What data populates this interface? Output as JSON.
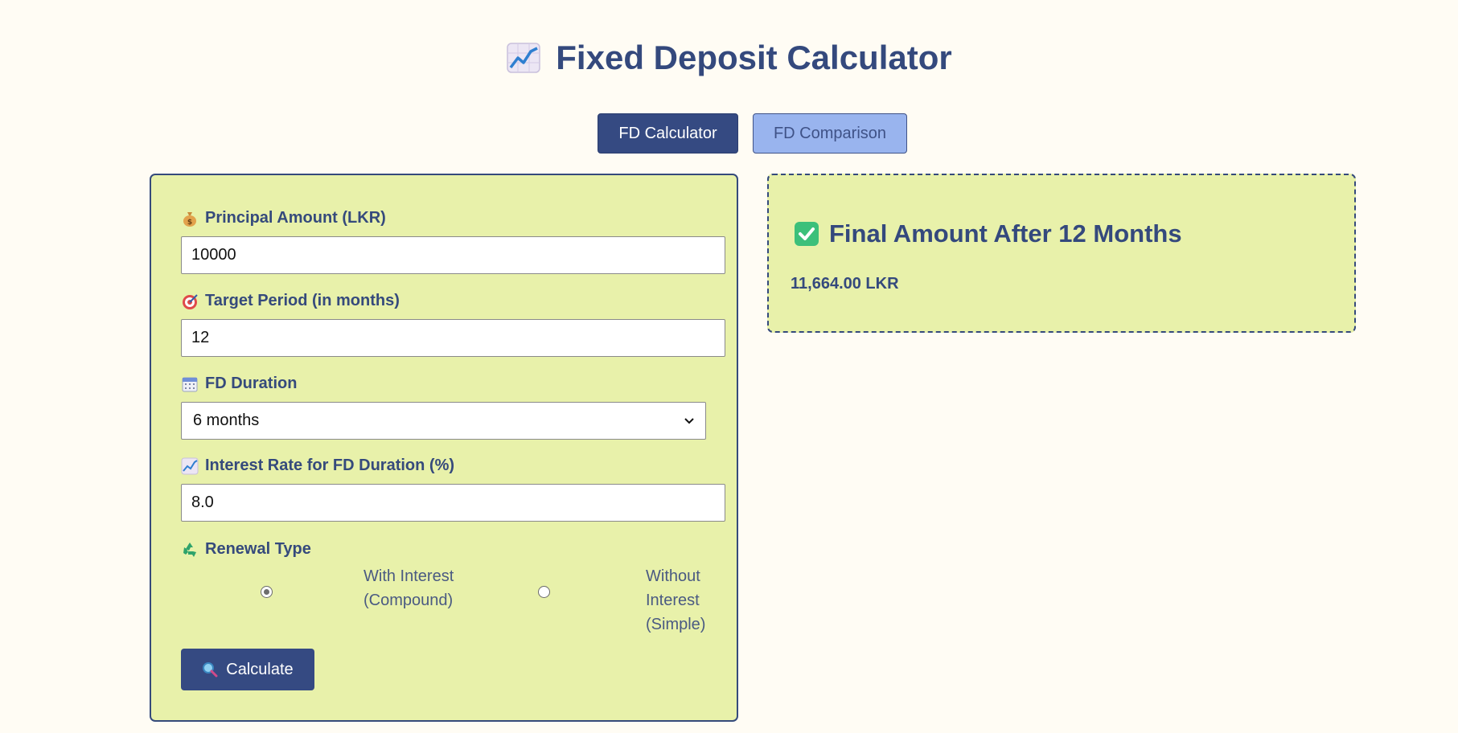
{
  "header": {
    "title": "Fixed Deposit Calculator",
    "title_icon": "chart-increasing-icon"
  },
  "tabs": [
    {
      "label": "FD Calculator",
      "active": true
    },
    {
      "label": "FD Comparison",
      "active": false
    }
  ],
  "form": {
    "principal": {
      "label": "Principal Amount (LKR)",
      "value": "10000",
      "icon": "money-bag-icon"
    },
    "target_period": {
      "label": "Target Period (in months)",
      "value": "12",
      "icon": "target-icon"
    },
    "fd_duration": {
      "label": "FD Duration",
      "selected": "6 months",
      "icon": "calendar-icon"
    },
    "interest_rate": {
      "label": "Interest Rate for FD Duration (%)",
      "value": "8.0",
      "icon": "chart-increasing-icon"
    },
    "renewal": {
      "label": "Renewal Type",
      "icon": "recycle-icon",
      "options": [
        {
          "label": "With Interest (Compound)",
          "checked": true
        },
        {
          "label": "Without Interest (Simple)",
          "checked": false
        }
      ]
    },
    "calculate_label": "Calculate",
    "calculate_icon": "magnifier-icon"
  },
  "result": {
    "title": "Final Amount After 12 Months",
    "value": "11,664.00 LKR",
    "icon": "check-mark-icon"
  },
  "colors": {
    "background": "#fffcf4",
    "card": "#e8f1aa",
    "primary": "#354a82",
    "secondary_tab": "#99b4ee",
    "text": "#34497d"
  }
}
